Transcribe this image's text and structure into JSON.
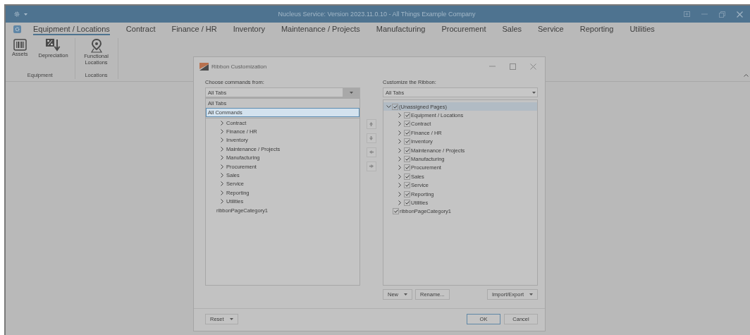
{
  "app": {
    "title": "Nucleus Service: Version 2023.11.0.10 - All Things Example Company"
  },
  "ribbon": {
    "tabs": [
      {
        "label": "Equipment / Locations",
        "selected": true
      },
      {
        "label": "Contract",
        "selected": false
      },
      {
        "label": "Finance / HR",
        "selected": false
      },
      {
        "label": "Inventory",
        "selected": false
      },
      {
        "label": "Maintenance / Projects",
        "selected": false
      },
      {
        "label": "Manufacturing",
        "selected": false
      },
      {
        "label": "Procurement",
        "selected": false
      },
      {
        "label": "Sales",
        "selected": false
      },
      {
        "label": "Service",
        "selected": false
      },
      {
        "label": "Reporting",
        "selected": false
      },
      {
        "label": "Utilities",
        "selected": false
      }
    ],
    "groups": [
      {
        "label": "Equipment",
        "commands": [
          {
            "label": "Assets",
            "kind": "barcode"
          },
          {
            "label": "Depreciation",
            "kind": "percent"
          }
        ]
      },
      {
        "label": "Locations",
        "commands": [
          {
            "label": "Functional Locations",
            "kind": "pin"
          }
        ]
      }
    ]
  },
  "dialog": {
    "title": "Ribbon Customization",
    "left": {
      "label": "Choose commands from:",
      "combo_value": "All Tabs",
      "dropdown": [
        {
          "label": "All Tabs",
          "selected": false
        },
        {
          "label": "All Commands",
          "selected": true
        }
      ],
      "tree": [
        {
          "label": "Contract",
          "expanded": false
        },
        {
          "label": "Finance / HR",
          "expanded": false
        },
        {
          "label": "Inventory",
          "expanded": false
        },
        {
          "label": "Maintenance / Projects",
          "expanded": false
        },
        {
          "label": "Manufacturing",
          "expanded": false
        },
        {
          "label": "Procurement",
          "expanded": false
        },
        {
          "label": "Sales",
          "expanded": false
        },
        {
          "label": "Service",
          "expanded": false
        },
        {
          "label": "Reporting",
          "expanded": false
        },
        {
          "label": "Utilities",
          "expanded": false
        },
        {
          "label": "ribbonPageCategory1"
        }
      ]
    },
    "right": {
      "label": "Customize the Ribbon:",
      "combo_value": "All Tabs",
      "tree": [
        {
          "label": "(Unassigned Pages)",
          "checked": true,
          "expanded": true,
          "selected": true,
          "children": [
            {
              "label": "Equipment / Locations",
              "checked": true,
              "expanded": false,
              "selected": false
            },
            {
              "label": "Contract",
              "checked": true,
              "expanded": false,
              "selected": false
            },
            {
              "label": "Finance / HR",
              "checked": true,
              "expanded": false,
              "selected": false
            },
            {
              "label": "Inventory",
              "checked": true,
              "expanded": false,
              "selected": false
            },
            {
              "label": "Maintenance / Projects",
              "checked": true,
              "expanded": false,
              "selected": false
            },
            {
              "label": "Manufacturing",
              "checked": true,
              "expanded": false,
              "selected": false
            },
            {
              "label": "Procurement",
              "checked": true,
              "expanded": false,
              "selected": false
            },
            {
              "label": "Sales",
              "checked": true,
              "expanded": false,
              "selected": false
            },
            {
              "label": "Service",
              "checked": true,
              "expanded": false,
              "selected": false
            },
            {
              "label": "Reporting",
              "checked": true,
              "expanded": false,
              "selected": false
            },
            {
              "label": "Utilities",
              "checked": true,
              "expanded": false,
              "selected": false
            }
          ]
        },
        {
          "label": "ribbonPageCategory1",
          "checked": true,
          "selected": false
        }
      ],
      "buttons": [
        {
          "label": "New",
          "dropdown": true
        },
        {
          "label": "Rename...",
          "dropdown": false
        },
        {
          "label": "Import/Export",
          "dropdown": true
        }
      ]
    },
    "footer": [
      {
        "label": "Reset",
        "dropdown": true,
        "default": false
      },
      {
        "label": "OK",
        "dropdown": false,
        "default": true
      },
      {
        "label": "Cancel",
        "dropdown": false,
        "default": false
      }
    ]
  }
}
